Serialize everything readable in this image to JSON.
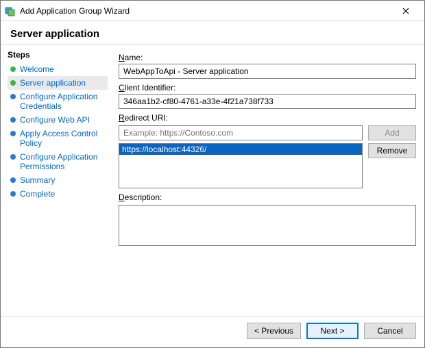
{
  "window": {
    "title": "Add Application Group Wizard"
  },
  "header": {
    "title": "Server application"
  },
  "sidebar": {
    "title": "Steps",
    "items": [
      {
        "label": "Welcome",
        "state": "done"
      },
      {
        "label": "Server application",
        "state": "done",
        "active": true
      },
      {
        "label": "Configure Application Credentials",
        "state": "pending"
      },
      {
        "label": "Configure Web API",
        "state": "pending"
      },
      {
        "label": "Apply Access Control Policy",
        "state": "pending"
      },
      {
        "label": "Configure Application Permissions",
        "state": "pending"
      },
      {
        "label": "Summary",
        "state": "pending"
      },
      {
        "label": "Complete",
        "state": "pending"
      }
    ]
  },
  "form": {
    "name_label_u": "N",
    "name_label_rest": "ame:",
    "name_value": "WebAppToApi - Server application",
    "client_label_u": "C",
    "client_label_rest": "lient Identifier:",
    "client_value": "346aa1b2-cf80-4761-a33e-4f21a738f733",
    "redirect_label_u": "R",
    "redirect_label_rest": "edirect URI:",
    "redirect_placeholder": "Example: https://Contoso.com",
    "add_u": "A",
    "add_rest": "dd",
    "remove_u": "R",
    "remove_rest": "emove",
    "uris": [
      {
        "value": "https://localhost:44326/",
        "selected": true
      }
    ],
    "desc_label_u": "D",
    "desc_label_rest": "escription:",
    "desc_value": ""
  },
  "buttons": {
    "previous": "< Previous",
    "next": "Next >",
    "cancel": "Cancel"
  }
}
